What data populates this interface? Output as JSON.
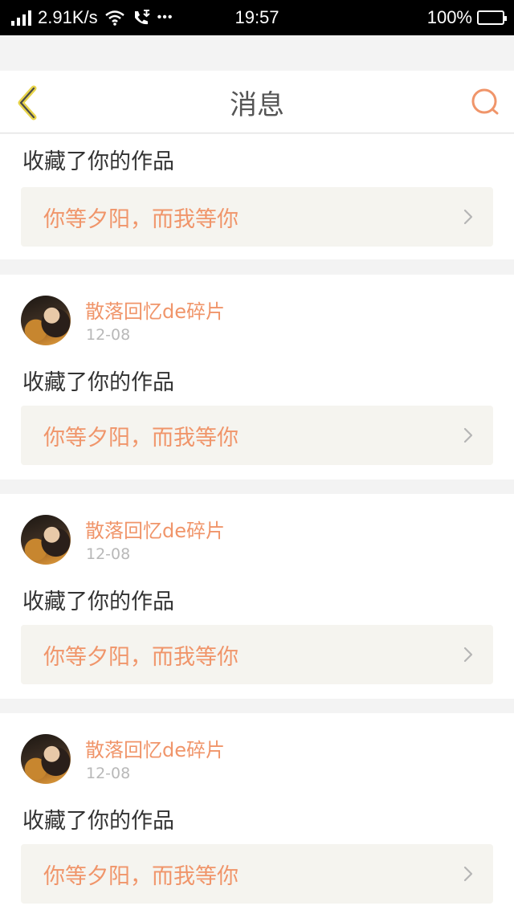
{
  "status_bar": {
    "speed": "2.91K/s",
    "dots": "•••",
    "time": "19:57",
    "battery": "100%"
  },
  "header": {
    "title": "消息",
    "back_icon": "chevron-left-icon",
    "search_icon": "search-icon"
  },
  "colors": {
    "accent": "#f0956a",
    "back_icon": "#e8d44a",
    "background": "#f3f3f3",
    "card_link_bg": "#f5f4ef"
  },
  "partial_card": {
    "action": "收藏了你的作品",
    "work_title": "你等夕阳，而我等你"
  },
  "messages": [
    {
      "username": "散落回忆de碎片",
      "date": "12-08",
      "action": "收藏了你的作品",
      "work_title": "你等夕阳，而我等你"
    },
    {
      "username": "散落回忆de碎片",
      "date": "12-08",
      "action": "收藏了你的作品",
      "work_title": "你等夕阳，而我等你"
    },
    {
      "username": "散落回忆de碎片",
      "date": "12-08",
      "action": "收藏了你的作品",
      "work_title": "你等夕阳，而我等你"
    }
  ]
}
